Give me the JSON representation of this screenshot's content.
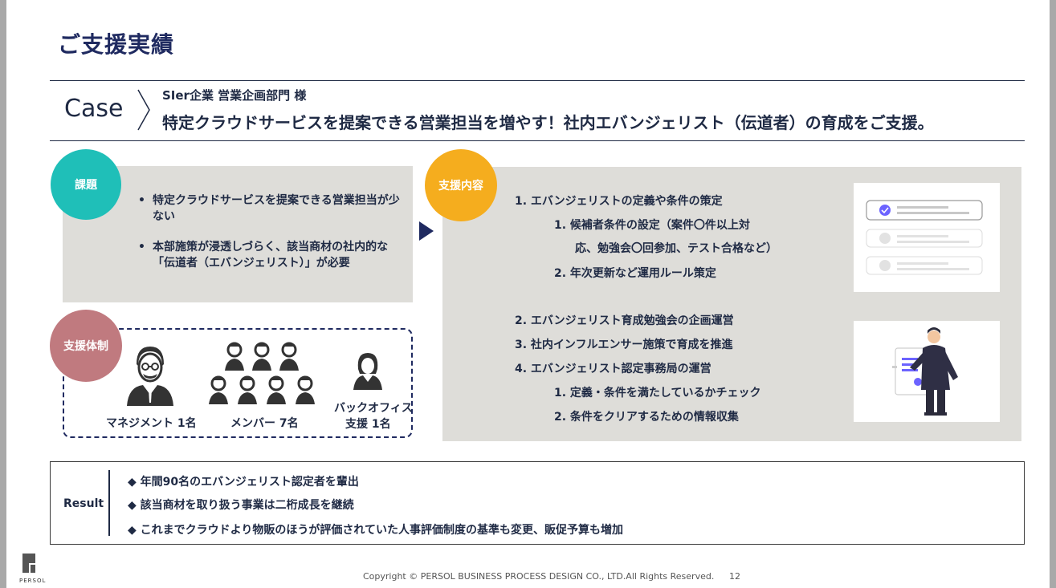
{
  "title": "ご支援実績",
  "case": {
    "label": "Case",
    "client": "SIer企業 営業企画部門 様",
    "headline": "特定クラウドサービスを提案できる営業担当を増やす！社内エバンジェリスト（伝道者）の育成をご支援。"
  },
  "issue": {
    "badge": "課題",
    "items": [
      "特定クラウドサービスを提案できる営業担当が少ない",
      "本部施策が浸透しづらく、該当商材の社内的な「伝道者（エバンジェリスト）」が必要"
    ]
  },
  "support": {
    "badge": "支援内容",
    "lines": [
      "1.  エバンジェリストの定義や条件の策定",
      "1.  候補者条件の設定（案件〇件以上対",
      "応、勉強会〇回参加、テスト合格など）",
      "2.  年次更新など運用ルール策定",
      "2.  エバンジェリスト育成勉強会の企画運営",
      "3.  社内インフルエンサー施策で育成を推進",
      "4.  エバンジェリスト認定事務局の運営",
      "1.  定義・条件を満たしているかチェック",
      "2.  条件をクリアするための情報収集"
    ]
  },
  "team": {
    "badge": "支援体制",
    "management": "マネジメント  1名",
    "members": "メンバー  7名",
    "backoffice_line1": "バックオフィス",
    "backoffice_line2": "支援 1名"
  },
  "result": {
    "label": "Result",
    "items": [
      "◆ 年間90名のエバンジェリスト認定者を輩出",
      "◆ 該当商材を取り扱う事業は二桁成長を継続",
      "◆ これまでクラウドより物販のほうが評価されていた人事評価制度の基準も変更、販促予算も増加"
    ]
  },
  "footer": {
    "copyright": "Copyright © PERSOL BUSINESS PROCESS DESIGN CO., LTD.All Rights Reserved.",
    "page": "12",
    "logo_text": "PERSOL"
  },
  "colors": {
    "navy": "#1f2a60",
    "teal": "#1fbfb8",
    "orange": "#f5ad1e",
    "rose": "#c07a7f",
    "gray_box": "#deddd9",
    "purple_check": "#6c63ff"
  }
}
